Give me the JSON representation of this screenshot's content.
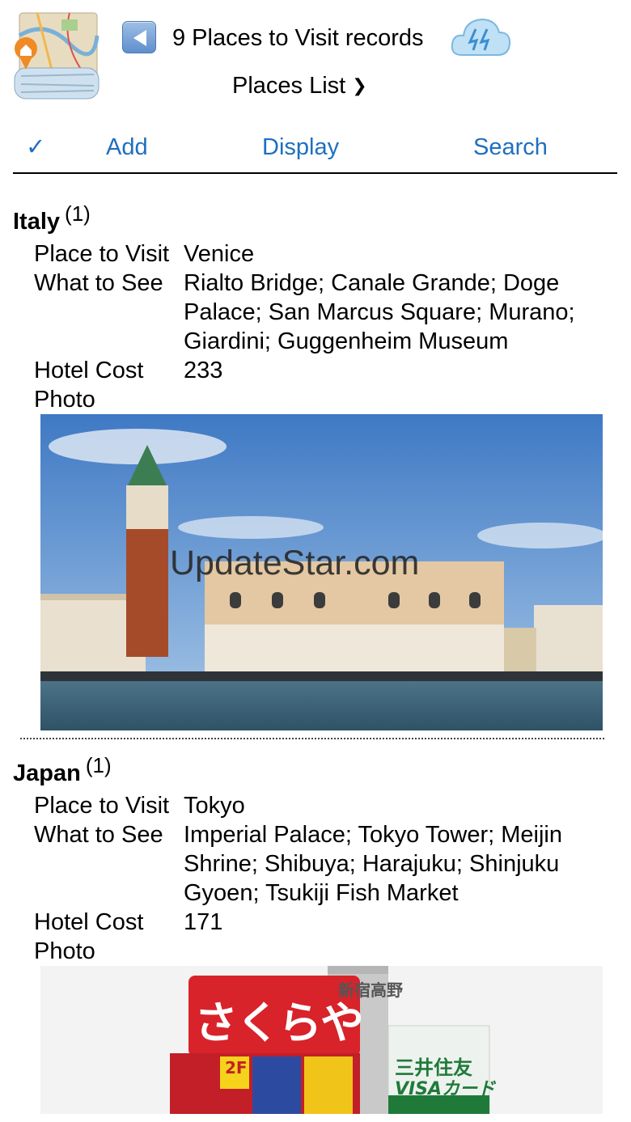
{
  "header": {
    "app_icon": "map-icon",
    "back_icon": "back-arrow-icon",
    "title": "9 Places to Visit records",
    "cloud_icon": "cloud-sync-icon",
    "places_link": "Places List",
    "chevron": "❯"
  },
  "toolbar": {
    "check": "✓",
    "add": "Add",
    "display": "Display",
    "search": "Search"
  },
  "records": [
    {
      "country": "Italy",
      "count": "(1)",
      "place_label": "Place to Visit",
      "place": "Venice",
      "see_label": "What to See",
      "see": "Rialto Bridge; Canale Grande; Doge Palace; San Marcus Square; Murano; Giardini; Guggenheim Museum",
      "cost_label": "Hotel Cost",
      "cost": "233",
      "photo_label": "Photo",
      "watermark": "UpdateStar.com"
    },
    {
      "country": "Japan",
      "count": "(1)",
      "place_label": "Place to Visit",
      "place": "Tokyo",
      "see_label": "What to See",
      "see": "Imperial Palace; Tokyo Tower; Meijin Shrine; Shibuya; Harajuku; Shinjuku Gyoen; Tsukiji Fish Market",
      "cost_label": "Hotel Cost",
      "cost": "171",
      "photo_label": "Photo",
      "sign_main": "さくらや",
      "sign_visa_top": "三井住友",
      "sign_visa_bottom": "VISAカード",
      "sign_tall": "新宿高野",
      "sign_2f": "2F"
    }
  ]
}
